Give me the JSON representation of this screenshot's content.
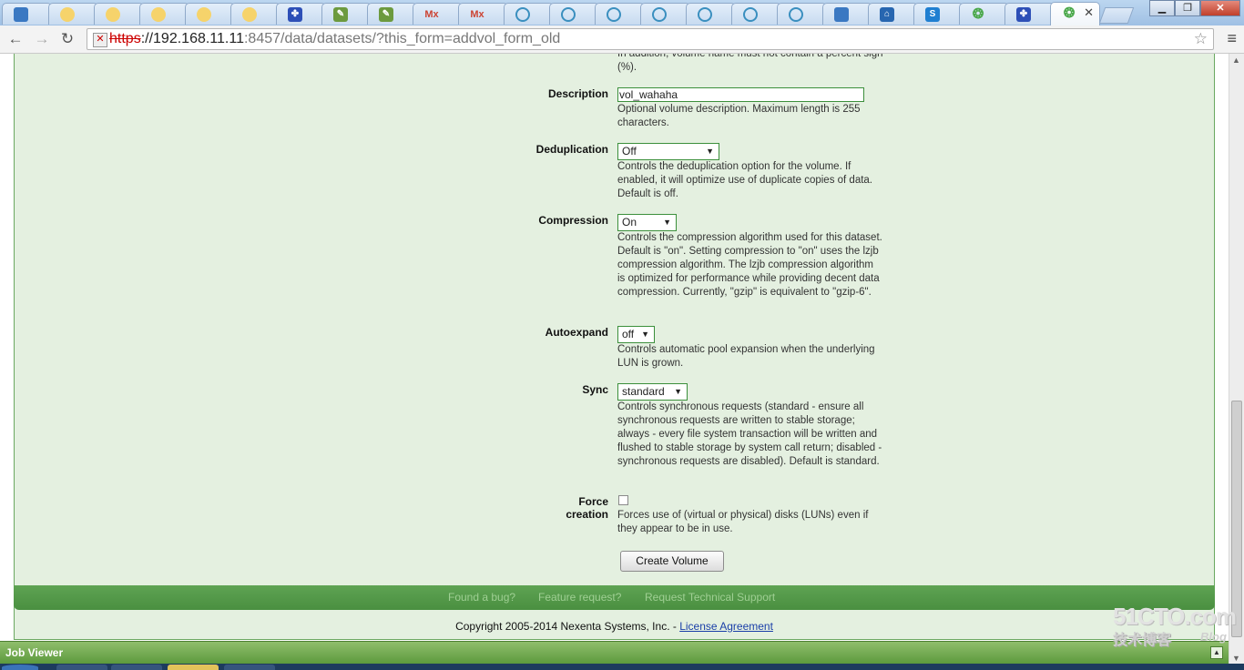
{
  "browser": {
    "tabs": [
      {
        "icon": "app-blue-icon"
      },
      {
        "icon": "sheep-icon"
      },
      {
        "icon": "sheep-icon"
      },
      {
        "icon": "sheep-icon"
      },
      {
        "icon": "sheep-icon"
      },
      {
        "icon": "paw-icon"
      },
      {
        "icon": "notebook-icon"
      },
      {
        "icon": "notebook-icon"
      },
      {
        "icon": "mx-icon",
        "text": "Mx"
      },
      {
        "icon": "mx-icon",
        "text": "Mx"
      },
      {
        "icon": "play-circle-icon"
      },
      {
        "icon": "play-circle-icon"
      },
      {
        "icon": "play-circle-icon"
      },
      {
        "icon": "play-circle-icon"
      },
      {
        "icon": "play-circle-icon"
      },
      {
        "icon": "play-circle-icon"
      },
      {
        "icon": "play-circle-icon"
      },
      {
        "icon": "app-blue-icon"
      },
      {
        "icon": "home-icon"
      },
      {
        "icon": "s-app-icon"
      },
      {
        "icon": "swirl-icon"
      },
      {
        "icon": "paw-icon"
      },
      {
        "icon": "swirl-icon",
        "active": true
      }
    ],
    "url": {
      "scheme": "https",
      "host": "://192.168.11.11",
      "rest": ":8457/data/datasets/?this_form=addvol_form_old"
    }
  },
  "form": {
    "top_partial": "In addition, volume name must not contain a percent sign (%).",
    "description": {
      "label": "Description",
      "value": "vol_wahaha",
      "help": "Optional volume description. Maximum length is 255 characters."
    },
    "deduplication": {
      "label": "Deduplication",
      "value": "Off",
      "help": "Controls the deduplication option for the volume. If enabled, it will optimize use of duplicate copies of data. Default is off."
    },
    "compression": {
      "label": "Compression",
      "value": "On",
      "help": "Controls the compression algorithm used for this dataset. Default is \"on\". Setting compression to \"on\" uses the lzjb compression algorithm. The lzjb compression algorithm is optimized for performance while providing decent data compression. Currently, \"gzip\" is equivalent to \"gzip-6\"."
    },
    "autoexpand": {
      "label": "Autoexpand",
      "value": "off",
      "help": "Controls automatic pool expansion when the underlying LUN is grown."
    },
    "sync": {
      "label": "Sync",
      "value": "standard",
      "help": "Controls synchronous requests (standard - ensure all synchronous requests are written to stable storage; always - every file system transaction will be written and flushed to stable storage by system call return; disabled - synchronous requests are disabled). Default is standard."
    },
    "force": {
      "label_line1": "Force",
      "label_line2": "creation",
      "checked": false,
      "help": "Forces use of (virtual or physical) disks (LUNs) even if they appear to be in use."
    },
    "submit_label": "Create Volume"
  },
  "footer": {
    "links": [
      "Found a bug?",
      "Feature request?",
      "Request Technical Support"
    ],
    "copyright": "Copyright 2005-2014 Nexenta Systems, Inc. - ",
    "license_link": "License Agreement"
  },
  "job_viewer": {
    "title": "Job Viewer"
  },
  "watermark": {
    "main": "51CTO.com",
    "sub": "技术博客",
    "blog": "Blog"
  },
  "colors": {
    "panel_bg": "#e4f0e0",
    "panel_border": "#6aa861",
    "footer_green": "#5ea353",
    "job_viewer_green": "#7bb05a",
    "link_blue": "#1a3fa8"
  }
}
